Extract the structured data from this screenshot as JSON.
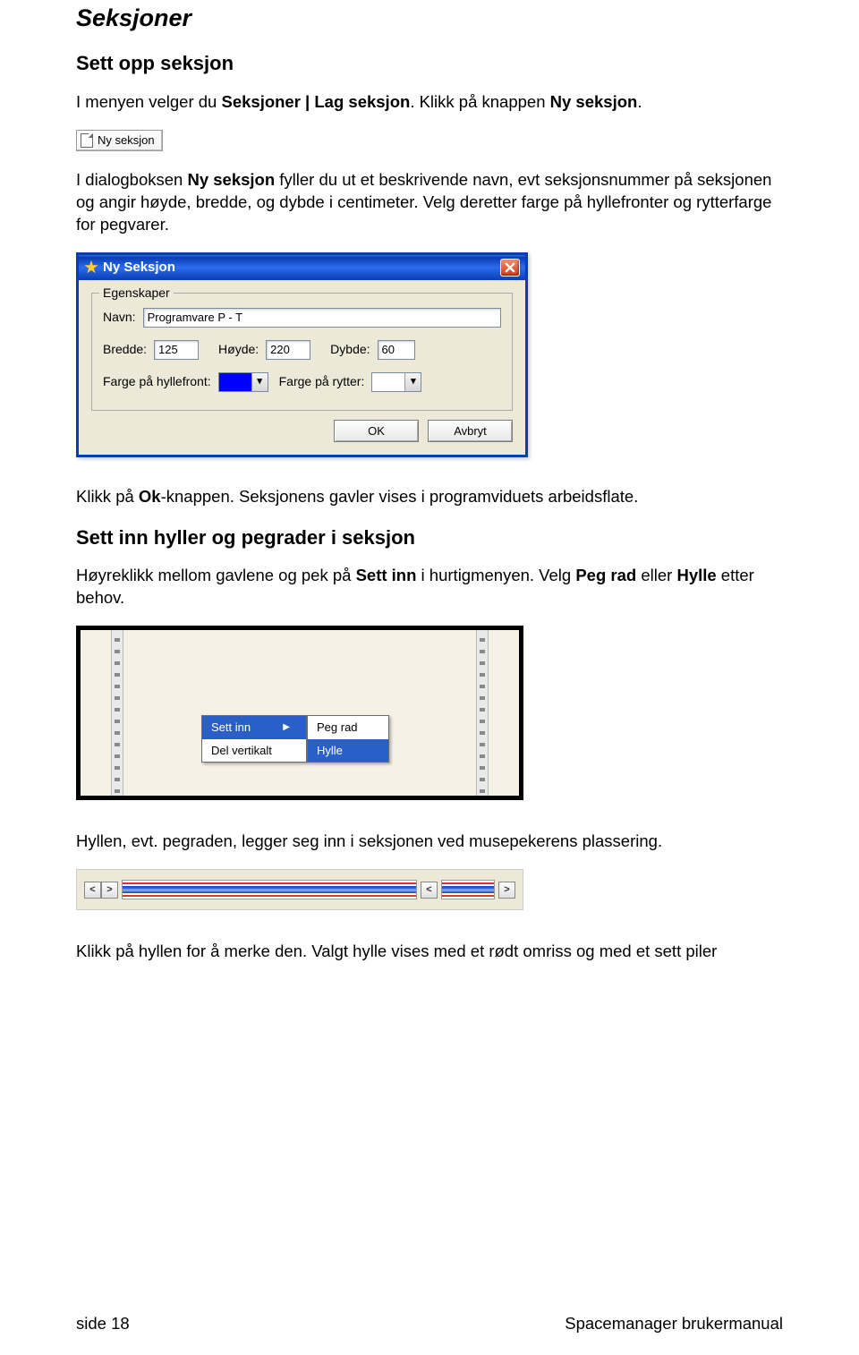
{
  "headings": {
    "main": "Seksjoner",
    "sub1": "Sett opp seksjon",
    "sub2": "Sett inn hyller og pegrader i seksjon"
  },
  "para": {
    "intro_pre": "I menyen velger du ",
    "intro_bold": "Seksjoner | Lag seksjon",
    "intro_mid": ". Klikk på knappen ",
    "intro_bold2": "Ny seksjon",
    "intro_end": ".",
    "p2_pre": "I dialogboksen ",
    "p2_b1": "Ny seksjon",
    "p2_rest": " fyller du ut et beskrivende navn, evt seksjonsnummer på seksjonen og angir høyde, bredde, og dybde i centimeter.  Velg deretter farge på hyllefronter og rytterfarge for pegvarer.",
    "p3_a": "Klikk på ",
    "p3_b": "Ok",
    "p3_c": "-knappen.  Seksjonens gavler vises i programviduets arbeidsflate.",
    "p4_a": "Høyreklikk mellom gavlene og pek på ",
    "p4_b": "Sett inn",
    "p4_c": " i hurtigmenyen.  Velg ",
    "p4_d": "Peg rad",
    "p4_e": " eller ",
    "p4_f": "Hylle",
    "p4_g": " etter behov.",
    "p5": "Hyllen, evt. pegraden, legger seg inn i seksjonen  ved musepekerens plassering.",
    "p6": "Klikk på hyllen for å merke den.  Valgt hylle vises med et rødt omriss og med et sett piler"
  },
  "ny_seksjon_button": "Ny seksjon",
  "dialog": {
    "title": "Ny Seksjon",
    "group": "Egenskaper",
    "navn_label": "Navn:",
    "navn_value": "Programvare P - T",
    "bredde_label": "Bredde:",
    "bredde_value": "125",
    "hoyde_label": "Høyde:",
    "hoyde_value": "220",
    "dybde_label": "Dybde:",
    "dybde_value": "60",
    "farge_front_label": "Farge på hyllefront:",
    "farge_rytter_label": "Farge på rytter:",
    "ok": "OK",
    "cancel": "Avbryt"
  },
  "context_menu": {
    "settinn": "Sett inn",
    "delvert": "Del vertikalt",
    "pegrad": "Peg rad",
    "hylle": "Hylle"
  },
  "footer": {
    "left": "side  18",
    "right": "Spacemanager brukermanual"
  }
}
